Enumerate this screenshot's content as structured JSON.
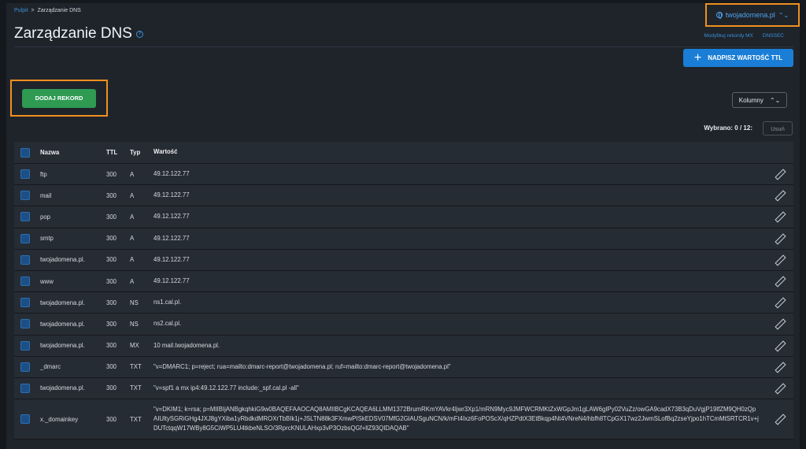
{
  "breadcrumb": {
    "root": "Pulpit",
    "separator": ">",
    "current": "Zarządzanie DNS"
  },
  "domain_selector": {
    "label": "twojadomena.pl",
    "icon": "globe-icon",
    "caret": "⌃⌄"
  },
  "page": {
    "title": "Zarządzanie DNS",
    "help_icon": "?"
  },
  "top_links": {
    "mx": "Modyfikuj rekordy MX",
    "dnssec": "DNSSEC"
  },
  "ttl_button": {
    "icon": "+",
    "label": "NADPISZ WARTOŚĆ TTL"
  },
  "add_button": {
    "label": "DODAJ REKORD"
  },
  "columns_button": {
    "label": "Kolumny",
    "caret": "⌃⌄"
  },
  "selection": {
    "text": "Wybrano: 0 / 12:"
  },
  "delete_button": {
    "label": "Usuń"
  },
  "table": {
    "headers": {
      "name": "Nazwa",
      "ttl": "TTL",
      "type": "Typ",
      "value": "Wartość"
    },
    "rows": [
      {
        "name": "ftp",
        "ttl": "300",
        "type": "A",
        "value": "49.12.122.77"
      },
      {
        "name": "mail",
        "ttl": "300",
        "type": "A",
        "value": "49.12.122.77"
      },
      {
        "name": "pop",
        "ttl": "300",
        "type": "A",
        "value": "49.12.122.77"
      },
      {
        "name": "smtp",
        "ttl": "300",
        "type": "A",
        "value": "49.12.122.77"
      },
      {
        "name": "twojadomena.pl.",
        "ttl": "300",
        "type": "A",
        "value": "49.12.122.77"
      },
      {
        "name": "www",
        "ttl": "300",
        "type": "A",
        "value": "49.12.122.77"
      },
      {
        "name": "twojadomena.pl.",
        "ttl": "300",
        "type": "NS",
        "value": "ns1.cal.pl."
      },
      {
        "name": "twojadomena.pl.",
        "ttl": "300",
        "type": "NS",
        "value": "ns2.cal.pl."
      },
      {
        "name": "twojadomena.pl.",
        "ttl": "300",
        "type": "MX",
        "value": "10 mail.twojadomena.pl."
      },
      {
        "name": "_dmarc",
        "ttl": "300",
        "type": "TXT",
        "value": "\"v=DMARC1; p=reject; rua=mailto:dmarc-report@twojadomena.pl; ruf=mailto:dmarc-report@twojadomena.pl\""
      },
      {
        "name": "twojadomena.pl.",
        "ttl": "300",
        "type": "TXT",
        "value": "\"v=spf1 a mx ip4:49.12.122.77 include:_spf.cal.pl -all\""
      },
      {
        "name": "x._domainkey",
        "ttl": "300",
        "type": "TXT",
        "value": "\"v=DKIM1; k=rsa; p=MIIBIjANBgkqhkiG9w0BAQEFAAOCAQ8AMIIBCgKCAQEA6LLMM1372BrumRKmYAVkr4Ijwr3Xp1/mRN9Myc9JMFWCRMKtZxWGpJm1gLAW6gIPy02VuZz/owGA9cadX73B3qDuVgjP19lfZM9QH0zQpAIUltySGRiGHg4JXJ8gYXiba1yRbdkdMROXrTbBIk1j+JSLTN88k3FXmwPISkEDSV07MfG2GlAUSguNCN/k/mFt4Ixz6FoPOScX/qHZPdtX3EtBkqp4Nt4VNreN4/hbfh8TCpGX17wz2JwmSLofBq2zseYjpo1hTCmMtSRTCR1v+jDUTctqqW17WBy8G5CiWP5LU4tkbeNLSO/3RprcKNULAHxp3vP3OzbsQGf+llZ93QIDAQAB\""
      }
    ]
  }
}
